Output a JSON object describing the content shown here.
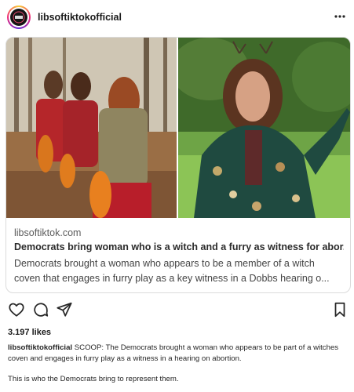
{
  "post": {
    "username": "libsoftiktokofficial",
    "more_icon": "more-horizontal-icon"
  },
  "link_card": {
    "domain": "libsoftiktok.com",
    "title": "Democrats bring woman who is a witch and a furry as witness for abor...",
    "description": "Democrats brought a woman who appears to be a member of a witch coven that engages in furry play as a key witness in a Dobbs hearing o..."
  },
  "actions": {
    "like_icon": "heart-icon",
    "comment_icon": "comment-icon",
    "share_icon": "send-icon",
    "save_icon": "bookmark-icon"
  },
  "likes": "3.197 likes",
  "caption": {
    "username": "libsoftiktokofficial",
    "text": "SCOOP: The Democrats brought a woman who appears to be part of a witches coven and engages in furry play as a witness in a hearing on abortion.",
    "second_line": "This is who the Democrats bring to represent them."
  }
}
